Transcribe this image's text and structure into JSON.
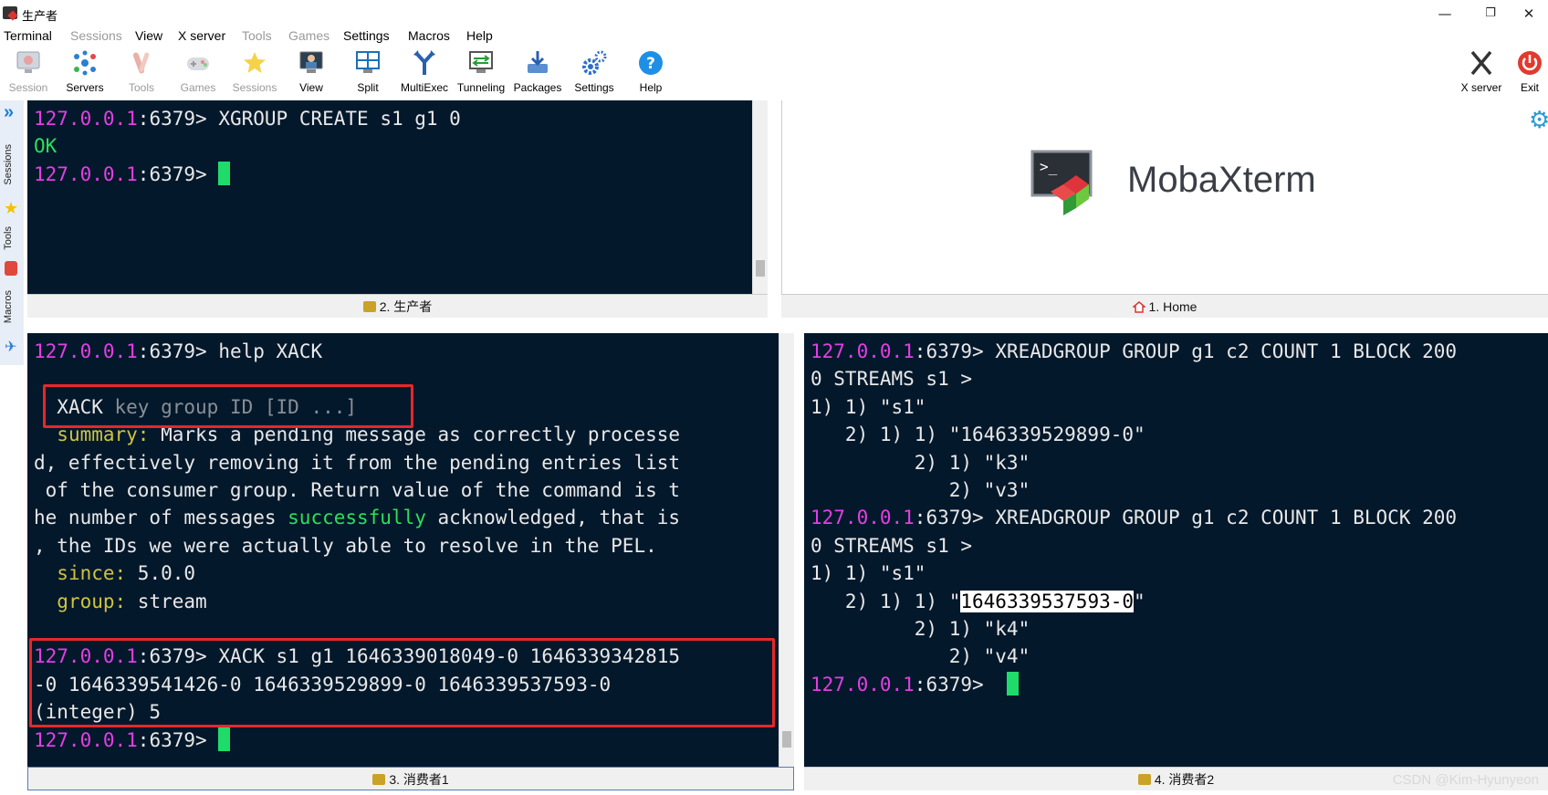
{
  "window": {
    "title": "生产者"
  },
  "menu": [
    "Terminal",
    "Sessions",
    "View",
    "X server",
    "Tools",
    "Games",
    "Settings",
    "Macros",
    "Help"
  ],
  "toolbar": {
    "session": "Session",
    "servers": "Servers",
    "tools": "Tools",
    "games": "Games",
    "sessions": "Sessions",
    "view": "View",
    "split": "Split",
    "multiexec": "MultiExec",
    "tunneling": "Tunneling",
    "packages": "Packages",
    "settings": "Settings",
    "help": "Help",
    "xserver": "X server",
    "exit": "Exit"
  },
  "sidebar": {
    "sessions": "Sessions",
    "tools": "Tools",
    "macros": "Macros"
  },
  "prompt": {
    "ip": "127.0.0.1",
    "port": ":6379> "
  },
  "pane1": {
    "cmd": "XGROUP CREATE s1 g1 0",
    "ok": "OK",
    "tab": "2. 生产者"
  },
  "home": {
    "brand": "MobaXterm",
    "tab": "1. Home"
  },
  "pane3": {
    "cmd1": "help XACK",
    "syntax_cmd": "XACK",
    "syntax_args": " key group ID [ID ...]",
    "summary_label": "summary:",
    "summary_1": " Marks a pending message as correctly processe",
    "summary_2": "d, effectively removing it from the pending entries list",
    "summary_3": " of the consumer group. Return value of the command is t",
    "summary_4a": "he number of messages ",
    "summary_4b": "successfully",
    "summary_4c": " acknowledged, that is",
    "summary_5": ", the IDs we were actually able to resolve in the PEL.",
    "since_label": "since:",
    "since_val": " 5.0.0",
    "group_label": "group:",
    "group_val": " stream",
    "ack_cmd_1": "XACK s1 g1 1646339018049-0 1646339342815",
    "ack_cmd_2": "-0 1646339541426-0 1646339529899-0 1646339537593-0",
    "ack_result": "(integer) 5",
    "tab": "3. 消费者1"
  },
  "pane4": {
    "cmd_a": "XREADGROUP GROUP g1 c2 COUNT 1 BLOCK 200",
    "cmd_b": "0 STREAMS s1 >",
    "r1_l1": "1) 1) \"s1\"",
    "r1_l2": "   2) 1) 1) \"1646339529899-0\"",
    "r1_l3": "         2) 1) \"k3\"",
    "r1_l4": "            2) \"v3\"",
    "r2_l1": "1) 1) \"s1\"",
    "r2_l2_pre": "   2) 1) 1) \"",
    "r2_id": "1646339537593-0",
    "r2_l2_post": "\"",
    "r2_l3": "         2) 1) \"k4\"",
    "r2_l4": "            2) \"v4\"",
    "tab": "4. 消费者2"
  },
  "watermark": "CSDN @Kim-Hyunyeon"
}
